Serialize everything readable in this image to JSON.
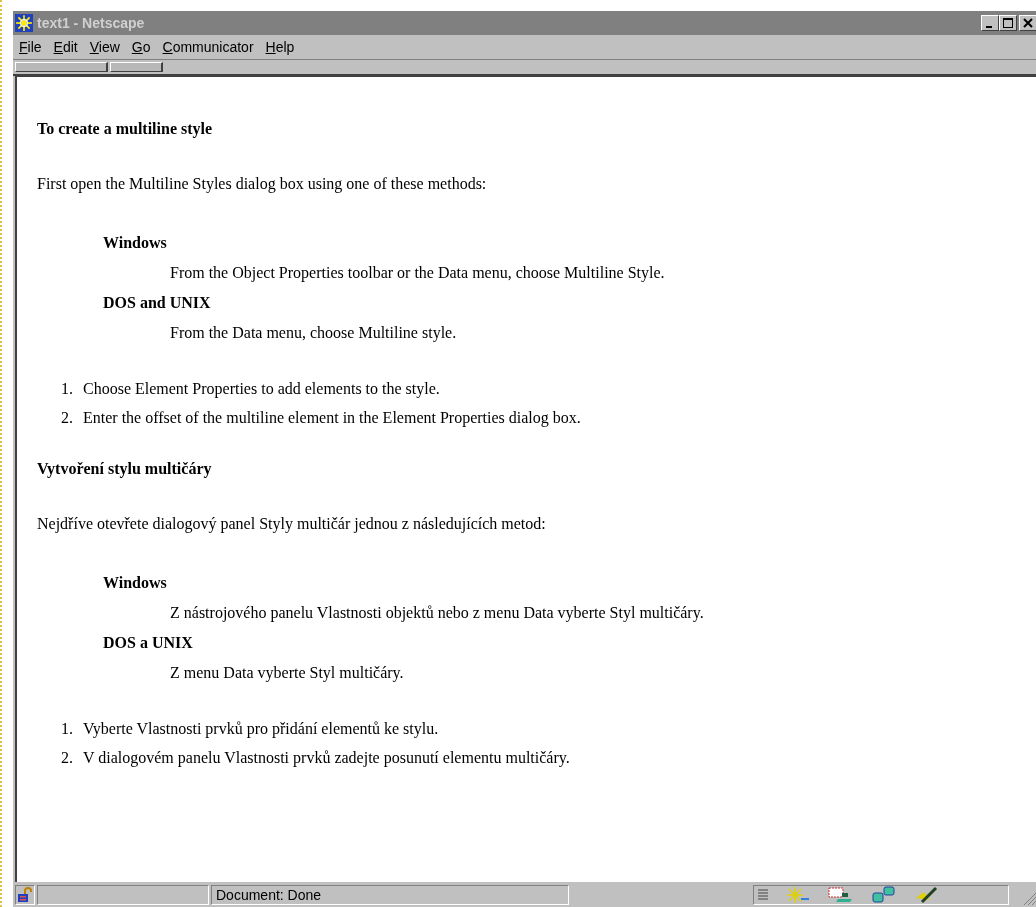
{
  "window": {
    "title": "text1 - Netscape"
  },
  "menu": [
    {
      "label": "File"
    },
    {
      "label": "Edit"
    },
    {
      "label": "View"
    },
    {
      "label": "Go"
    },
    {
      "label": "Communicator"
    },
    {
      "label": "Help"
    }
  ],
  "sections": [
    {
      "heading": "To create a multiline style",
      "intro": "First open the Multiline Styles dialog box using one of these methods:",
      "platforms": [
        {
          "name": "Windows",
          "text": "From the Object Properties toolbar or the Data menu, choose Multiline Style."
        },
        {
          "name": "DOS and UNIX",
          "text": "From the Data menu, choose Multiline style."
        }
      ],
      "steps": [
        {
          "number": "1.",
          "text": "Choose Element Properties to add elements to the style."
        },
        {
          "number": "2.",
          "text": "Enter the offset of the multiline element in the Element Properties dialog box."
        }
      ]
    },
    {
      "heading": "Vytvoření stylu multičáry",
      "intro": "Nejdříve otevřete dialogový panel Styly multičár jednou z následujících metod:",
      "platforms": [
        {
          "name": "Windows",
          "text": "Z nástrojového panelu Vlastnosti objektů nebo z menu Data vyberte Styl multičáry."
        },
        {
          "name": "DOS a UNIX",
          "text": "Z menu Data vyberte Styl multičáry."
        }
      ],
      "steps": [
        {
          "number": "1.",
          "text": "Vyberte Vlastnosti prvků pro přidání elementů ke stylu."
        },
        {
          "number": "2.",
          "text": "V dialogovém panelu Vlastnosti prvků zadejte posunutí elementu multičáry."
        }
      ]
    }
  ],
  "status_bar": {
    "text": "Document: Done"
  }
}
